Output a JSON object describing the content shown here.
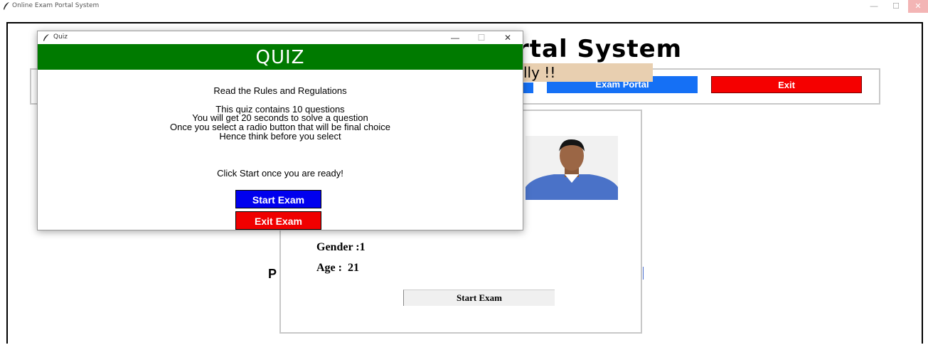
{
  "main_window": {
    "title": "Online Exam Portal System",
    "min_glyph": "—",
    "max_glyph": "☐",
    "close_glyph": "✕"
  },
  "header": {
    "title_visible": "rtal System",
    "welcome_visible": "lly !!"
  },
  "nav": {
    "exam_portal_label": "Exam Portal",
    "exit_label": "Exit"
  },
  "profile": {
    "gender": "Gender :1",
    "age": "Age :  21",
    "start_exam_label": "Start Exam",
    "partial_letter": "P"
  },
  "quiz": {
    "title": "Quiz",
    "header": "QUIZ",
    "rules_heading": "Read the Rules and Regulations",
    "rules": [
      "This quiz contains 10 questions",
      "You will get 20 seconds to solve a question",
      "Once you select a radio button that will be final choice",
      "Hence think before you select"
    ],
    "ready_text": "Click Start once you are ready!",
    "start_button": "Start Exam",
    "exit_button": "Exit Exam",
    "min_glyph": "—",
    "max_glyph": "☐",
    "close_glyph": "✕"
  },
  "colors": {
    "quiz_header_bg": "#007a00",
    "start_blue": "#0000ee",
    "exit_red": "#f00000",
    "nav_blue": "#1570f5",
    "welcome_bg": "#e8cfb0"
  },
  "icons": {
    "window_icon": "feather-icon"
  }
}
